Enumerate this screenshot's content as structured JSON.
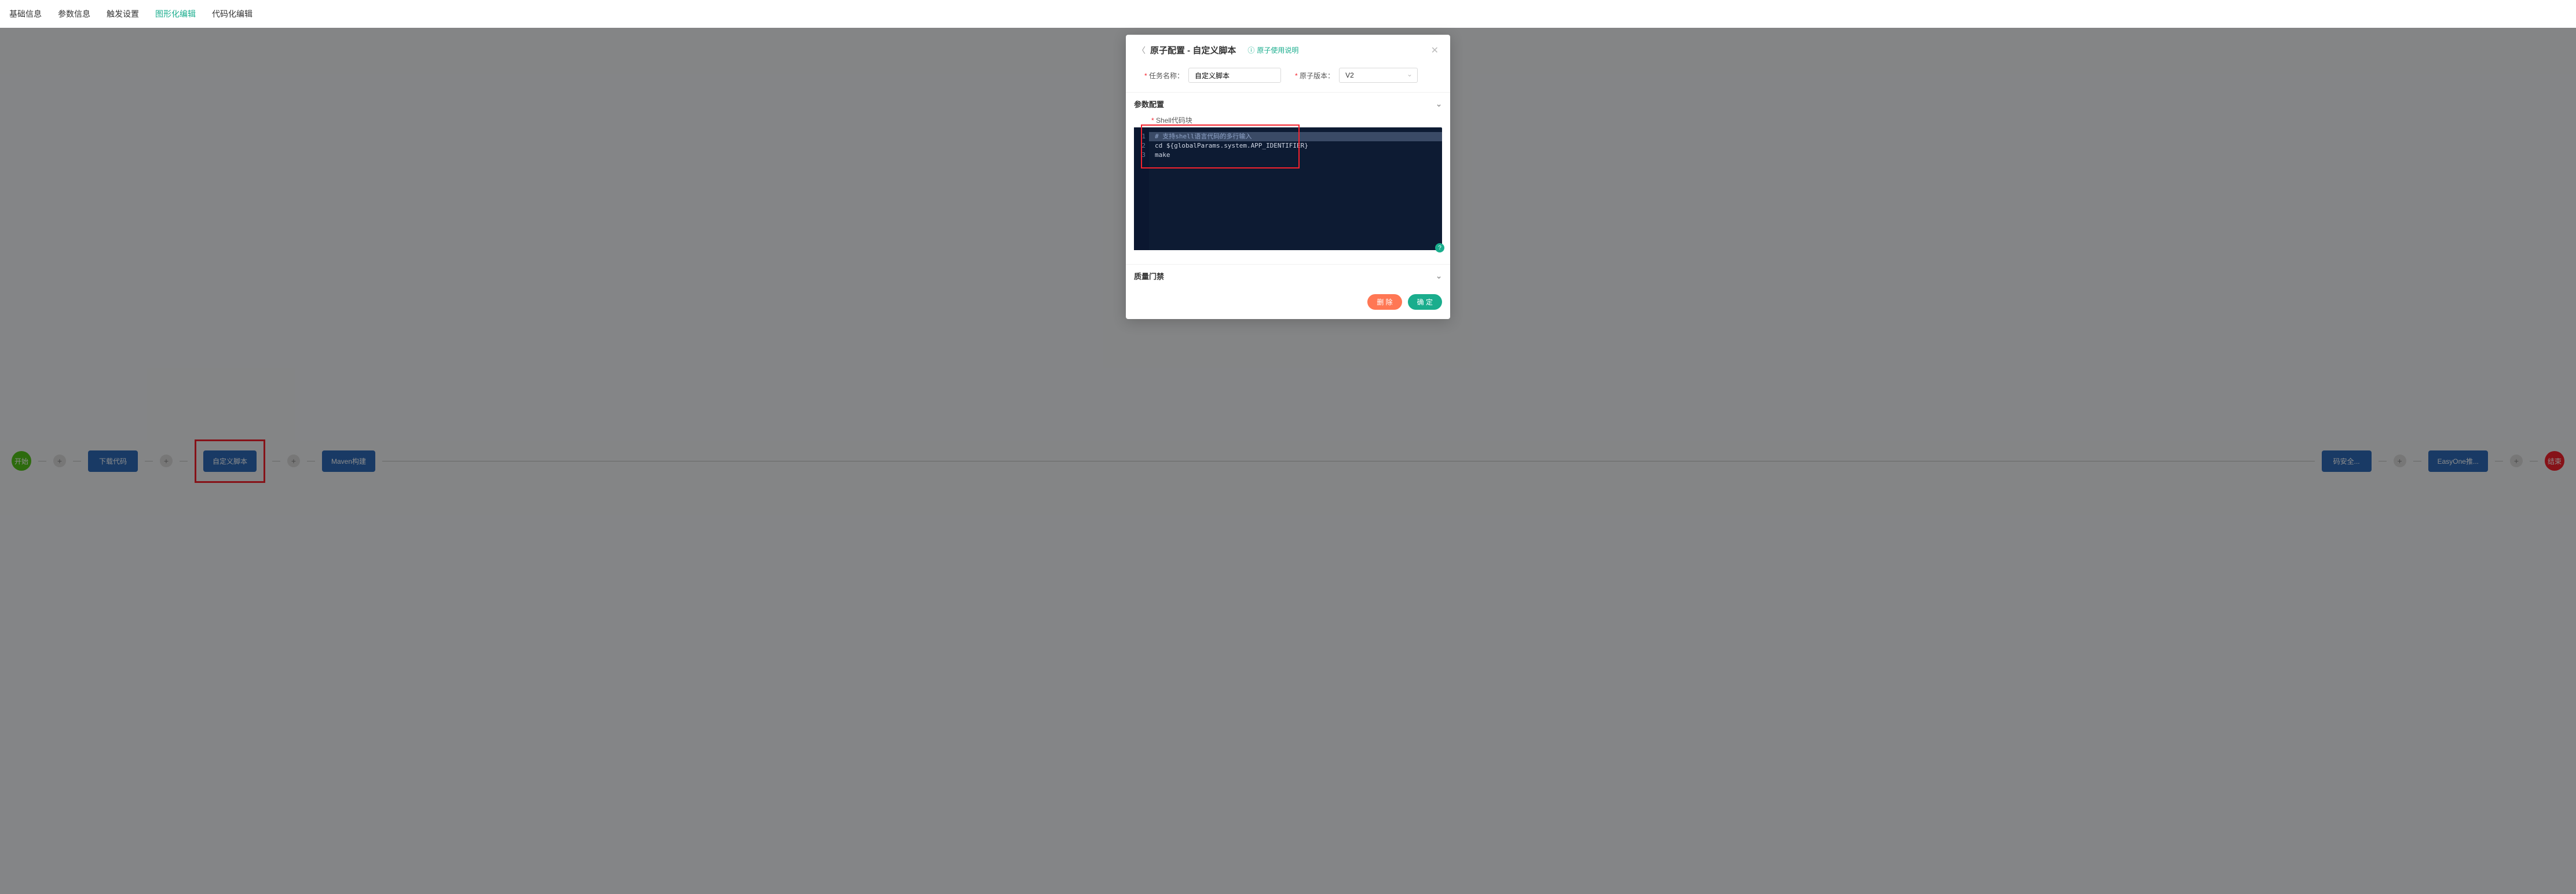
{
  "tabs": {
    "items": [
      {
        "label": "基础信息",
        "active": false
      },
      {
        "label": "参数信息",
        "active": false
      },
      {
        "label": "触发设置",
        "active": false
      },
      {
        "label": "图形化编辑",
        "active": true
      },
      {
        "label": "代码化编辑",
        "active": false
      }
    ]
  },
  "flow": {
    "start": "开始",
    "end": "结束",
    "stages": [
      "下载代码",
      "自定义脚本",
      "Maven构建",
      "码安全...",
      "EasyOne推..."
    ]
  },
  "modal": {
    "title": "原子配置 - 自定义脚本",
    "helpLink": "原子使用说明",
    "taskNameLabel": "任务名称：",
    "taskNameValue": "自定义脚本",
    "versionLabel": "原子版本：",
    "versionValue": "V2",
    "paramSectionTitle": "参数配置",
    "codeLabel": "Shell代码块",
    "codeLines": [
      "# 支持shell语言代码的多行输入",
      "cd ${globalParams.system.APP_IDENTIFIER}",
      "make"
    ],
    "qualitySectionTitle": "质量门禁",
    "deleteBtn": "删 除",
    "okBtn": "确 定"
  }
}
